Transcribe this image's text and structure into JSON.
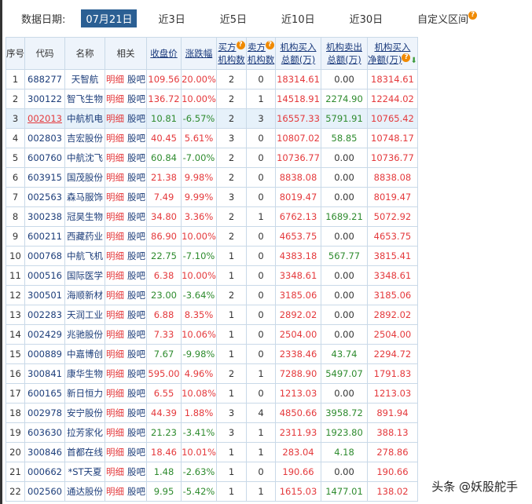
{
  "filter": {
    "label": "数据日期:",
    "selected": "07月21日",
    "options": [
      "近3日",
      "近5日",
      "近10日",
      "近30日"
    ],
    "custom": "自定义区间"
  },
  "headers": {
    "idx": "序号",
    "code": "代码",
    "name": "名称",
    "rel": "相关",
    "close": "收盘价",
    "chg": "涨跌幅",
    "buy_n1": "买方",
    "buy_n2": "机构数",
    "sell_n1": "卖方",
    "sell_n2": "机构数",
    "buy_amt1": "机构买入",
    "buy_amt2": "总额(万)",
    "sell_amt1": "机构卖出",
    "sell_amt2": "总额(万)",
    "net1": "机构买入",
    "net2": "净额(万)"
  },
  "rel_links": [
    "明细",
    "股吧"
  ],
  "rows": [
    [
      "1",
      "688277",
      "天智航",
      "109.56",
      "20.00%",
      "2",
      "0",
      "18314.61",
      "0.00",
      "18314.61"
    ],
    [
      "2",
      "300122",
      "智飞生物",
      "136.72",
      "10.00%",
      "2",
      "1",
      "14518.91",
      "2274.90",
      "12244.02"
    ],
    [
      "3",
      "002013",
      "中航机电",
      "10.81",
      "-6.57%",
      "2",
      "3",
      "16557.33",
      "5791.91",
      "10765.42"
    ],
    [
      "4",
      "002803",
      "吉宏股份",
      "40.45",
      "5.61%",
      "3",
      "0",
      "10807.02",
      "58.85",
      "10748.17"
    ],
    [
      "5",
      "600760",
      "中航沈飞",
      "60.84",
      "-7.00%",
      "2",
      "0",
      "10736.77",
      "0.00",
      "10736.77"
    ],
    [
      "6",
      "603915",
      "国茂股份",
      "21.38",
      "9.98%",
      "2",
      "0",
      "8838.08",
      "0.00",
      "8838.08"
    ],
    [
      "7",
      "002563",
      "森马服饰",
      "7.49",
      "9.99%",
      "3",
      "0",
      "8019.47",
      "0.00",
      "8019.47"
    ],
    [
      "8",
      "300238",
      "冠昊生物",
      "34.80",
      "3.36%",
      "2",
      "1",
      "6762.13",
      "1689.21",
      "5072.92"
    ],
    [
      "9",
      "600211",
      "西藏药业",
      "86.90",
      "10.00%",
      "2",
      "0",
      "4653.75",
      "0.00",
      "4653.75"
    ],
    [
      "10",
      "000768",
      "中航飞机",
      "22.75",
      "-7.10%",
      "1",
      "0",
      "4383.18",
      "567.77",
      "3815.41"
    ],
    [
      "11",
      "000516",
      "国际医学",
      "6.38",
      "10.00%",
      "1",
      "0",
      "3348.61",
      "0.00",
      "3348.61"
    ],
    [
      "12",
      "300501",
      "海顺新材",
      "23.00",
      "-3.64%",
      "2",
      "0",
      "3185.06",
      "0.00",
      "3185.06"
    ],
    [
      "13",
      "002283",
      "天润工业",
      "6.88",
      "8.35%",
      "1",
      "0",
      "2892.02",
      "0.00",
      "2892.02"
    ],
    [
      "14",
      "002429",
      "兆驰股份",
      "7.33",
      "10.06%",
      "1",
      "0",
      "2504.00",
      "0.00",
      "2504.00"
    ],
    [
      "15",
      "000889",
      "中嘉博创",
      "7.67",
      "-9.98%",
      "1",
      "0",
      "2338.46",
      "43.74",
      "2294.72"
    ],
    [
      "16",
      "300841",
      "康华生物",
      "595.00",
      "4.96%",
      "2",
      "1",
      "7288.90",
      "5497.07",
      "1791.83"
    ],
    [
      "17",
      "600165",
      "新日恒力",
      "6.55",
      "10.08%",
      "1",
      "0",
      "1213.03",
      "0.00",
      "1213.03"
    ],
    [
      "18",
      "002978",
      "安宁股份",
      "44.39",
      "1.88%",
      "3",
      "4",
      "4850.66",
      "3958.72",
      "891.94"
    ],
    [
      "19",
      "603630",
      "拉芳家化",
      "21.23",
      "-3.41%",
      "3",
      "1",
      "2311.93",
      "1923.80",
      "388.13"
    ],
    [
      "20",
      "300846",
      "首都在线",
      "18.46",
      "10.01%",
      "1",
      "1",
      "283.04",
      "4.18",
      "278.86"
    ],
    [
      "21",
      "000662",
      "*ST天夏",
      "1.48",
      "-2.63%",
      "1",
      "0",
      "190.66",
      "0.00",
      "190.66"
    ],
    [
      "22",
      "002560",
      "通达股份",
      "9.95",
      "-5.42%",
      "1",
      "1",
      "1615.03",
      "1477.01",
      "138.02"
    ]
  ],
  "watermark": "头条 @妖股舵手"
}
